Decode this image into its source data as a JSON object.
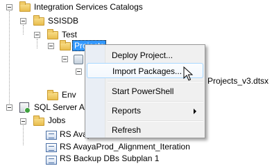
{
  "tree": {
    "integration_services_catalogs": "Integration Services Catalogs",
    "ssisdb": "SSISDB",
    "test": "Test",
    "projects": "Projects",
    "env_partial": "Env",
    "dtsx_partial": "Projects_v3.dtsx",
    "sql_server_agent_partial": "SQL Server Age",
    "jobs": "Jobs",
    "job_items": [
      "RS Avaya",
      "RS AvayaProd_Alignment_Iteration",
      "RS Backup DBs Subplan 1"
    ]
  },
  "context_menu": {
    "items": [
      "Deploy Project...",
      "Import Packages...",
      "Start PowerShell",
      "Reports",
      "Refresh"
    ],
    "hovered_index": 1
  },
  "colors": {
    "selection": "#3399ff",
    "menu_bg": "#f0f0f0",
    "hover_border": "#a8d8ff"
  }
}
